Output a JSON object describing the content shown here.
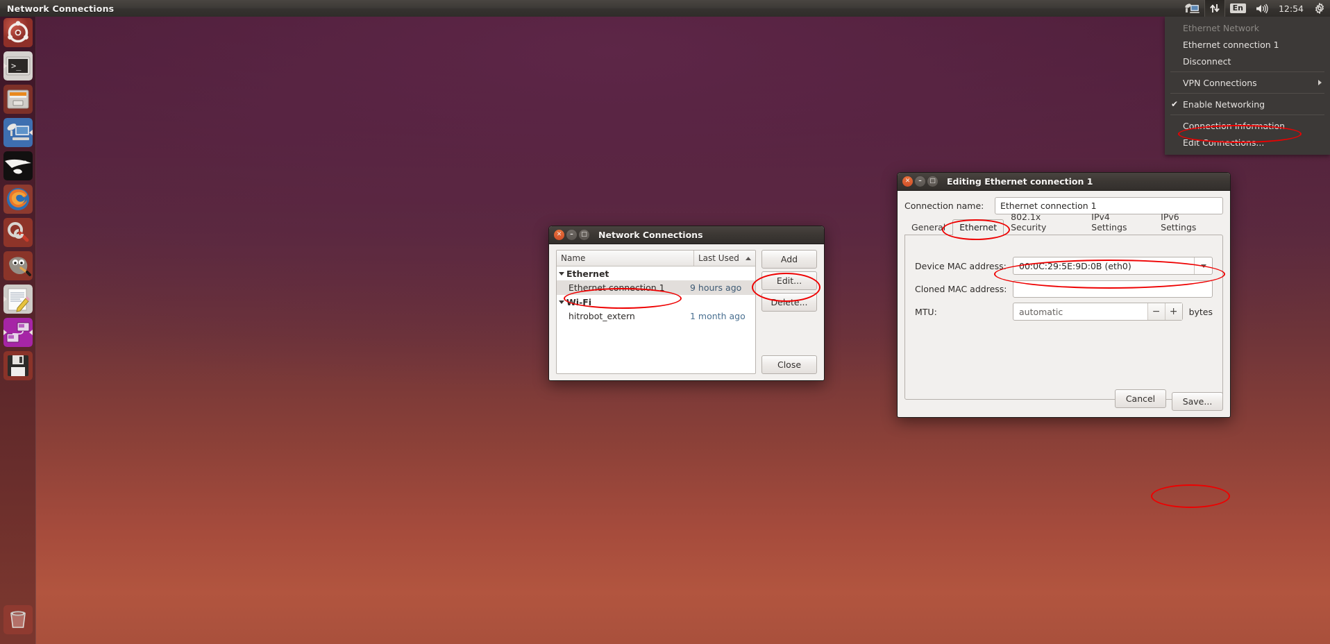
{
  "panel": {
    "title": "Network Connections",
    "indicators": [
      {
        "name": "remote-desktop-icon",
        "label": ""
      },
      {
        "name": "network-icon",
        "label": ""
      },
      {
        "name": "keyboard-layout-icon",
        "label": "En"
      },
      {
        "name": "volume-icon",
        "label": ""
      },
      {
        "name": "clock",
        "label": "12:54"
      },
      {
        "name": "system-settings-icon",
        "label": ""
      }
    ],
    "clock": "12:54",
    "keyboard_layout": "En"
  },
  "launcher": {
    "items": [
      {
        "name": "ubuntu-dash-icon",
        "label": "Dash home"
      },
      {
        "name": "terminal-icon",
        "label": "Terminal"
      },
      {
        "name": "files-icon",
        "label": "Files"
      },
      {
        "name": "remote-desktop-icon",
        "label": "Remote Desktop Viewer"
      },
      {
        "name": "amazon-icon",
        "label": "Amazon"
      },
      {
        "name": "firefox-icon",
        "label": "Firefox Web Browser"
      },
      {
        "name": "system-settings-icon",
        "label": "System Settings"
      },
      {
        "name": "gimp-icon",
        "label": "GIMP"
      },
      {
        "name": "text-editor-icon",
        "label": "Text Editor"
      },
      {
        "name": "workspace-switcher-icon",
        "label": "Workspace Switcher"
      },
      {
        "name": "save-disk-icon",
        "label": "Disk"
      },
      {
        "name": "trash-icon",
        "label": "Trash"
      }
    ]
  },
  "network_menu": {
    "section_header": "Ethernet Network",
    "items": [
      {
        "label": "Ethernet connection 1",
        "type": "connection",
        "checked": false
      },
      {
        "label": "Disconnect",
        "type": "action",
        "checked": false
      },
      {
        "label": "VPN Connections",
        "type": "submenu",
        "checked": false
      },
      {
        "label": "Enable Networking",
        "type": "checkbox",
        "checked": true
      },
      {
        "label": "Connection Information",
        "type": "action",
        "checked": false
      },
      {
        "label": "Edit Connections...",
        "type": "action",
        "checked": false
      }
    ],
    "check_glyph": "✔"
  },
  "network_connections_window": {
    "title": "Network Connections",
    "columns": {
      "name": "Name",
      "last_used": "Last Used"
    },
    "sort_column": "Last Used",
    "groups": [
      {
        "name": "Ethernet",
        "rows": [
          {
            "name": "Ethernet connection 1",
            "last_used": "9 hours ago",
            "selected": true
          }
        ]
      },
      {
        "name": "Wi-Fi",
        "rows": [
          {
            "name": "hitrobot_extern",
            "last_used": "1 month ago",
            "selected": false
          }
        ]
      }
    ],
    "buttons": {
      "add": "Add",
      "edit": "Edit...",
      "delete": "Delete...",
      "close": "Close"
    }
  },
  "editing_window": {
    "title": "Editing Ethernet connection 1",
    "connection_name_label": "Connection name:",
    "connection_name_value": "Ethernet connection 1",
    "tabs": [
      {
        "label": "General",
        "active": false
      },
      {
        "label": "Ethernet",
        "active": true
      },
      {
        "label": "802.1x Security",
        "active": false
      },
      {
        "label": "IPv4 Settings",
        "active": false
      },
      {
        "label": "IPv6 Settings",
        "active": false
      }
    ],
    "fields": {
      "device_mac_label": "Device MAC address:",
      "device_mac_value": "00:0C:29:5E:9D:0B (eth0)",
      "cloned_mac_label": "Cloned MAC address:",
      "cloned_mac_value": "",
      "mtu_label": "MTU:",
      "mtu_value": "automatic",
      "mtu_units": "bytes",
      "mtu_minus": "−",
      "mtu_plus": "+"
    },
    "buttons": {
      "cancel": "Cancel",
      "save": "Save..."
    }
  },
  "annotations": {
    "color": "#ee0000",
    "targets": [
      "edit-connections-menu-item",
      "ethernet-connection-1-row",
      "edit-button",
      "ethernet-tab",
      "device-mac-combo",
      "save-button"
    ]
  }
}
